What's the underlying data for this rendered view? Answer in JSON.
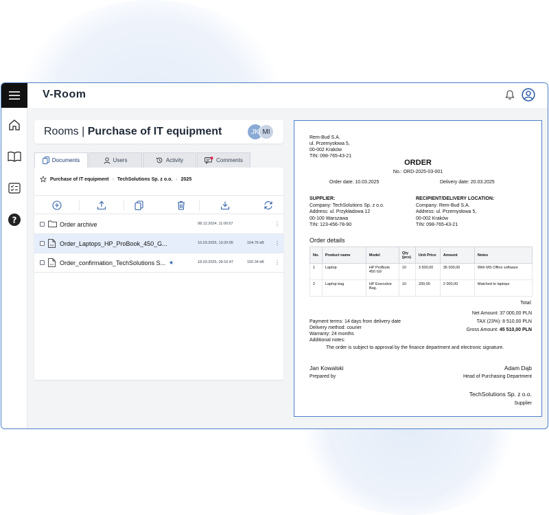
{
  "app": {
    "logo": "V-Room"
  },
  "header": {
    "title_prefix": "Rooms",
    "title_separator": "|",
    "title_main": "Purchase of IT equipment"
  },
  "avatars": [
    "JK",
    "MI"
  ],
  "tabs": [
    {
      "label": "Documents",
      "icon": "documents-icon",
      "active": true
    },
    {
      "label": "Users",
      "icon": "user-icon",
      "active": false
    },
    {
      "label": "Activity",
      "icon": "history-icon",
      "active": false
    },
    {
      "label": "Comments",
      "icon": "comments-icon",
      "active": false
    }
  ],
  "breadcrumb": [
    "Purchase of IT equipment",
    "TechSolutions Sp. z o.o.",
    "2025"
  ],
  "files": [
    {
      "name": "Order archive",
      "type": "folder",
      "date": "08.12.2024, 11:00:57",
      "size": "",
      "starred": false
    },
    {
      "name": "Order_Laptops_HP_ProBook_450_G...",
      "type": "pdf",
      "date": "10.03.2025, 13:20:05",
      "size": "104.76 kB",
      "starred": false,
      "selected": true
    },
    {
      "name": "Order_confirmation_TechSolutions S...",
      "type": "pdf",
      "date": "18.03.2025, 09:10:47",
      "size": "150.34 kB",
      "starred": true
    }
  ],
  "order": {
    "sender": [
      "Rem-Bud S.A.",
      "ul. Przemysłowa 5,",
      "00-002 Kraków",
      "TIN: 098-765-43-21"
    ],
    "title": "ORDER",
    "number": "No.: ORD-2025-03-001",
    "order_date": "Order date: 10.03.2025",
    "delivery_date": "Delivery date: 20.03.2025",
    "supplier_h": "SUPPLIER:",
    "supplier": [
      "Company: TechSolutions Sp. z o.o.",
      "Address: ul. Przykładowa 12",
      "00-100 Warszawa",
      "TIN: 123-456-78-90"
    ],
    "recipient_h": "RECIPIENT/DELIVERY LOCATION:",
    "recipient": [
      "Company: Rem-Bud S.A.",
      "Address: ul. Przemysłowa 5,",
      "00-002 Kraków",
      "TIN: 098-765-43-21"
    ],
    "details_h": "Order details",
    "columns": [
      "No.",
      "Product name",
      "Model",
      "Qty (pcs)",
      "Unit Price",
      "Amount",
      "Notes"
    ],
    "rows": [
      [
        "1",
        "Laptop",
        "HP ProBook 450 G9",
        "10",
        "3 500,00",
        "35 000,00",
        "With MS Office software"
      ],
      [
        "2",
        "Laptop bag",
        "HP Executive Bag.",
        "10",
        "200,00",
        "2 000,00",
        "Matched to laptops"
      ]
    ],
    "total_h": "Total:",
    "net": "Net Amount: 37 000,00 PLN",
    "tax": "TAX (23%): 8 510,00 PLN",
    "gross_label": "Gross Amount: ",
    "gross_value": "45 510,00 PLN",
    "payment": "Payment terms: 14 days from delivery date",
    "delivery_method": "Delivery method: courier",
    "warranty": "Warranty: 24 months",
    "notes_h": "Additional notes:",
    "note": "The order is subject to approval by the finance department and electronic signature.",
    "sign_left_name": "Jan Kowalski",
    "sign_left_role": "Prepared by",
    "sign_right_name": "Adam Dąb",
    "sign_right_role": "Head of Purchasing Department",
    "company": "TechSolutions Sp. z o.o.",
    "company_role": "Supplier"
  },
  "colors": {
    "accent": "#4a7fc9",
    "primary_text": "#1e3a6e",
    "notification": "#e11d48"
  }
}
